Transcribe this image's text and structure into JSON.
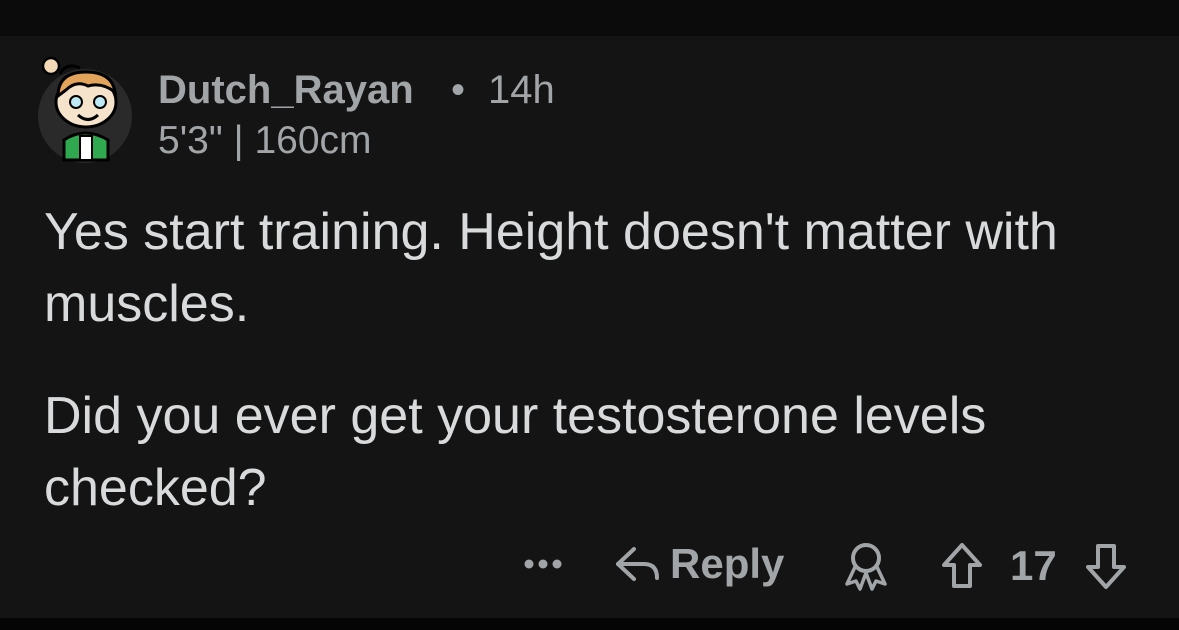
{
  "comment": {
    "author": "Dutch_Rayan",
    "separator": "•",
    "age": "14h",
    "flair": "5'3\" | 160cm",
    "paragraphs": [
      "Yes start training. Height doesn't matter with muscles.",
      "Did you ever get your testosterone levels checked?"
    ]
  },
  "actions": {
    "more_icon": "ellipsis-icon",
    "reply_icon": "reply-arrow-icon",
    "reply_label": "Reply",
    "award_icon": "award-icon",
    "upvote_icon": "upvote-arrow-icon",
    "score": "17",
    "downvote_icon": "downvote-arrow-icon"
  },
  "colors": {
    "background": "#141414",
    "text_primary": "#d8dadc",
    "text_secondary": "#a2a5a8",
    "avatar_hair": "#e2a35a",
    "avatar_jacket": "#2fa84f"
  }
}
